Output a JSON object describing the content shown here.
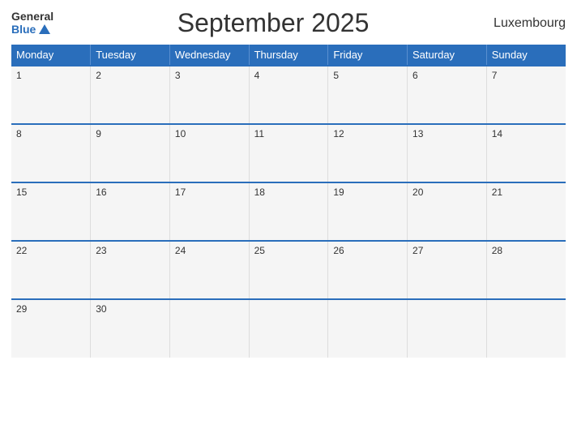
{
  "header": {
    "logo_general": "General",
    "logo_blue": "Blue",
    "title": "September 2025",
    "country": "Luxembourg"
  },
  "days": [
    "Monday",
    "Tuesday",
    "Wednesday",
    "Thursday",
    "Friday",
    "Saturday",
    "Sunday"
  ],
  "weeks": [
    [
      "1",
      "2",
      "3",
      "4",
      "5",
      "6",
      "7"
    ],
    [
      "8",
      "9",
      "10",
      "11",
      "12",
      "13",
      "14"
    ],
    [
      "15",
      "16",
      "17",
      "18",
      "19",
      "20",
      "21"
    ],
    [
      "22",
      "23",
      "24",
      "25",
      "26",
      "27",
      "28"
    ],
    [
      "29",
      "30",
      "",
      "",
      "",
      "",
      ""
    ]
  ]
}
